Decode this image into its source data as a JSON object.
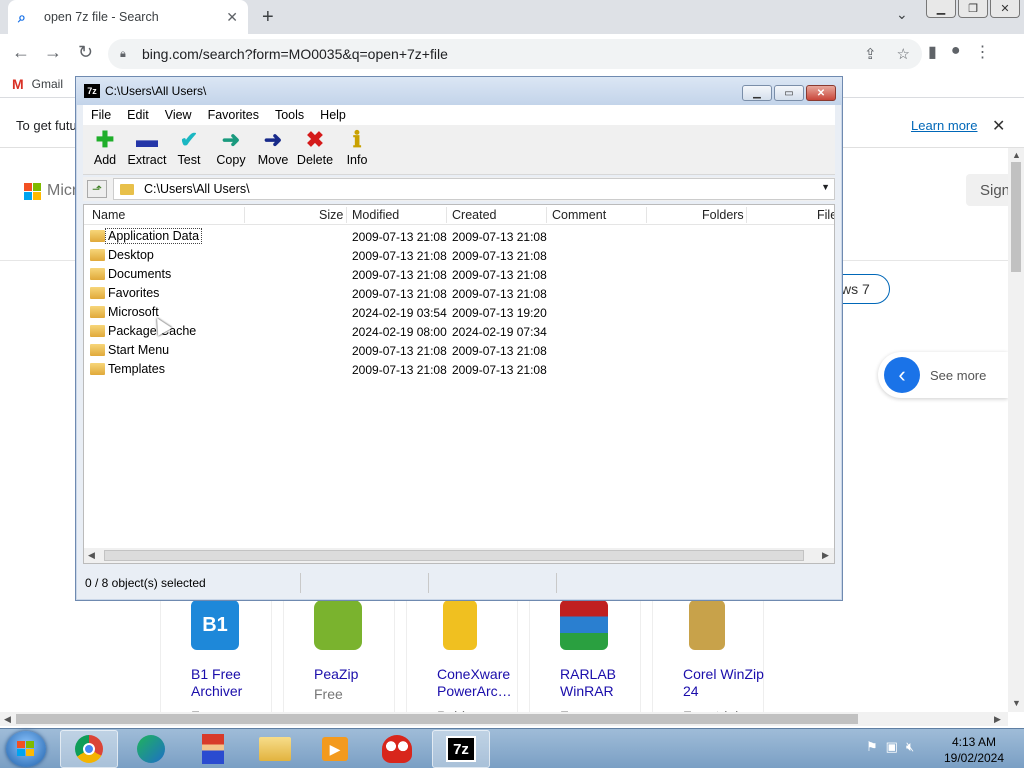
{
  "browser": {
    "tab_title": "open 7z file - Search",
    "tab_favicon": "search-icon",
    "url": "bing.com/search?form=MO0035&q=open+7z+file",
    "bookmark_gmail": "Gmail"
  },
  "page": {
    "infobar_text": "To get futu",
    "learn_more": "Learn more",
    "ms_name": "Micr",
    "signin": "Sign",
    "w7_pill": "ws 7",
    "see_more": "See more",
    "cards": [
      {
        "name": "B1 Free Archiver",
        "sub": "Free",
        "color": "#1e88d9"
      },
      {
        "name": "PeaZip",
        "sub": "Free",
        "color": "#7ab32e"
      },
      {
        "name": "ConeXware PowerArc…",
        "sub": "Paid",
        "color": "#f0c020"
      },
      {
        "name": "RARLAB WinRAR",
        "sub": "Free",
        "color": "#8b1f8b"
      },
      {
        "name": "Corel WinZip 24",
        "sub": "Free trial",
        "color": "#c8a24a"
      }
    ]
  },
  "app": {
    "title": "C:\\Users\\All Users\\",
    "icon_label": "7z",
    "menu": [
      "File",
      "Edit",
      "View",
      "Favorites",
      "Tools",
      "Help"
    ],
    "toolbar": [
      {
        "label": "Add",
        "icon": "add-icon",
        "glyph": "✚",
        "color": "#1fae2a"
      },
      {
        "label": "Extract",
        "icon": "extract-icon",
        "glyph": "▬",
        "color": "#2536a8"
      },
      {
        "label": "Test",
        "icon": "test-icon",
        "glyph": "✔",
        "color": "#1bb7c2"
      },
      {
        "label": "Copy",
        "icon": "copy-icon",
        "glyph": "➜",
        "color": "#1a9a7e"
      },
      {
        "label": "Move",
        "icon": "move-icon",
        "glyph": "➜",
        "color": "#182a8a"
      },
      {
        "label": "Delete",
        "icon": "delete-icon",
        "glyph": "✖",
        "color": "#d41a1a"
      },
      {
        "label": "Info",
        "icon": "info-icon",
        "glyph": "ℹ",
        "color": "#c9a100"
      }
    ],
    "address_path": "C:\\Users\\All Users\\",
    "columns": [
      "Name",
      "Size",
      "Modified",
      "Created",
      "Comment",
      "Folders",
      "File"
    ],
    "rows": [
      {
        "name": "Application Data",
        "modified": "2009-07-13 21:08",
        "created": "2009-07-13 21:08"
      },
      {
        "name": "Desktop",
        "modified": "2009-07-13 21:08",
        "created": "2009-07-13 21:08"
      },
      {
        "name": "Documents",
        "modified": "2009-07-13 21:08",
        "created": "2009-07-13 21:08"
      },
      {
        "name": "Favorites",
        "modified": "2009-07-13 21:08",
        "created": "2009-07-13 21:08"
      },
      {
        "name": "Microsoft",
        "modified": "2024-02-19 03:54",
        "created": "2009-07-13 19:20"
      },
      {
        "name": "Package Cache",
        "modified": "2024-02-19 08:00",
        "created": "2024-02-19 07:34"
      },
      {
        "name": "Start Menu",
        "modified": "2009-07-13 21:08",
        "created": "2009-07-13 21:08"
      },
      {
        "name": "Templates",
        "modified": "2009-07-13 21:08",
        "created": "2009-07-13 21:08"
      }
    ],
    "status": "0 / 8 object(s) selected"
  },
  "taskbar": {
    "apps": [
      "chrome-icon",
      "edge-icon",
      "mario-icon",
      "file-explorer-icon",
      "media-player-icon",
      "mushroom-icon",
      "7zip-icon"
    ],
    "active_label": "7z",
    "time": "4:13 AM",
    "date": "19/02/2024"
  }
}
